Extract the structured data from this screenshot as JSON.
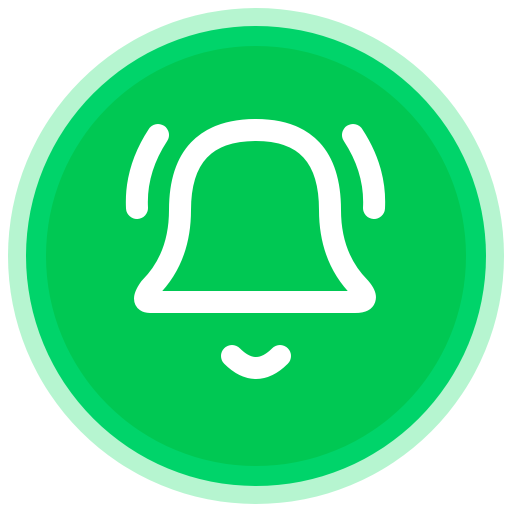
{
  "icon": {
    "name": "notification-bell-icon",
    "colors": {
      "halo": "#b6f5d0",
      "rim": "#00d46a",
      "disc": "#00c853",
      "glyph": "#ffffff"
    }
  }
}
